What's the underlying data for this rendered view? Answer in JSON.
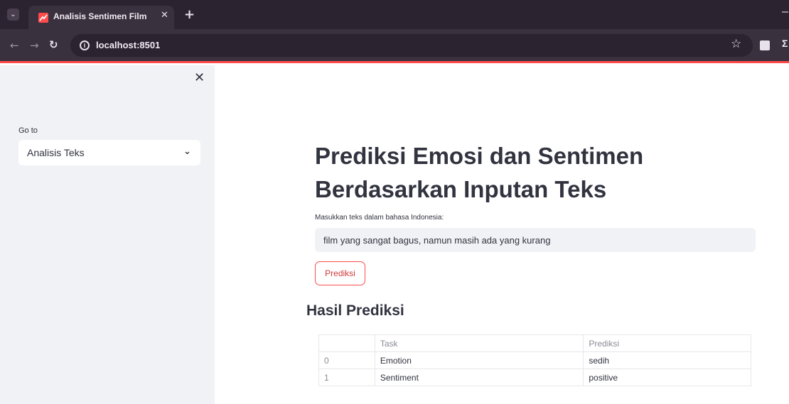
{
  "browser": {
    "tab_title": "Analisis Sentimen Film",
    "url": "localhost:8501",
    "accent": "#ff4b4b"
  },
  "sidebar": {
    "goto_label": "Go to",
    "select_value": "Analisis Teks"
  },
  "main": {
    "title_line1": "Prediksi Emosi dan Sentimen",
    "title_line2": "Berdasarkan Inputan Teks",
    "input_label": "Masukkan teks dalam bahasa Indonesia:",
    "input_value": "film yang sangat bagus, namun masih ada yang kurang",
    "button_label": "Prediksi",
    "result_heading": "Hasil Prediksi",
    "table": {
      "headers": [
        "",
        "Task",
        "Prediksi"
      ],
      "rows": [
        [
          "0",
          "Emotion",
          "sedih"
        ],
        [
          "1",
          "Sentiment",
          "positive"
        ]
      ]
    }
  }
}
